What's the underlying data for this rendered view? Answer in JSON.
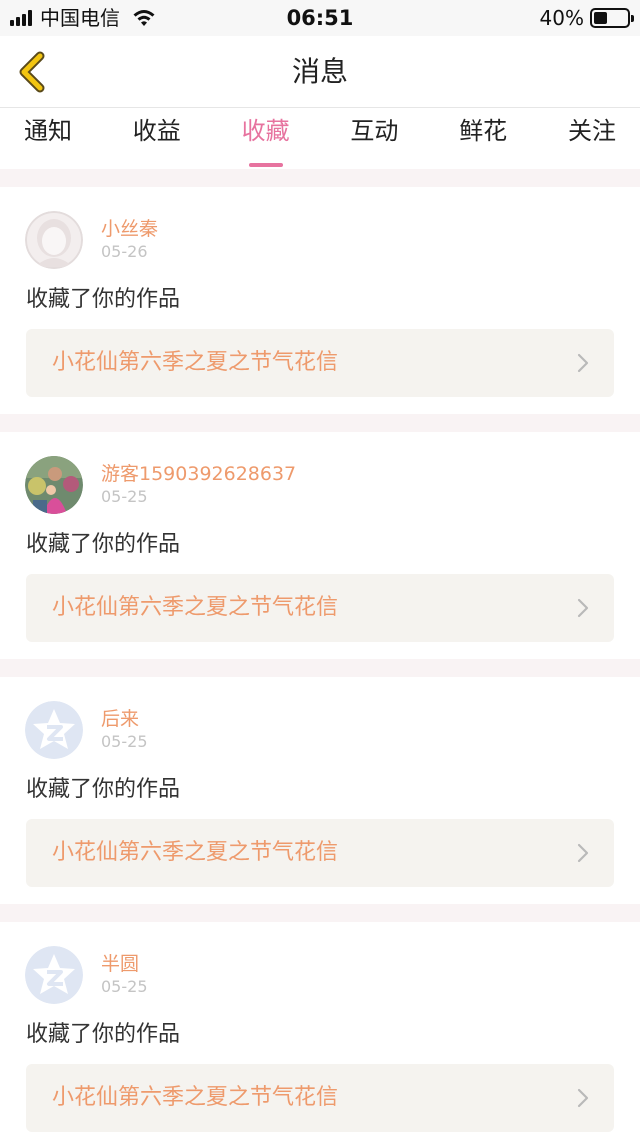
{
  "status_bar": {
    "carrier": "中国电信",
    "time": "06:51",
    "battery_percent": "40%",
    "battery_level": 0.4,
    "signal_icon": "signal-bars-icon",
    "wifi_icon": "wifi-icon"
  },
  "nav": {
    "title": "消息",
    "back_icon": "chevron-left-icon",
    "accent_color": "#f2c511"
  },
  "tabs": [
    {
      "label": "通知",
      "active": false
    },
    {
      "label": "收益",
      "active": false
    },
    {
      "label": "收藏",
      "active": true
    },
    {
      "label": "互动",
      "active": false
    },
    {
      "label": "鲜花",
      "active": false
    },
    {
      "label": "关注",
      "active": false
    }
  ],
  "colors": {
    "tab_active": "#e7739f",
    "name": "#ee9a6c",
    "work_title": "#ee9a6c",
    "separator": "#f9f3f4"
  },
  "messages": [
    {
      "user": "小丝秦",
      "date": "05-26",
      "action": "收藏了你的作品",
      "work": "小花仙第六季之夏之节气花信",
      "avatar": "default-girl-avatar-icon"
    },
    {
      "user": "游客1590392628637",
      "date": "05-25",
      "action": "收藏了你的作品",
      "work": "小花仙第六季之夏之节气花信",
      "avatar": "user-photo-avatar"
    },
    {
      "user": "后来",
      "date": "05-25",
      "action": "收藏了你的作品",
      "work": "小花仙第六季之夏之节气花信",
      "avatar": "qzone-star-avatar-icon"
    },
    {
      "user": "半圆",
      "date": "05-25",
      "action": "收藏了你的作品",
      "work": "小花仙第六季之夏之节气花信",
      "avatar": "qzone-star-avatar-icon"
    }
  ]
}
